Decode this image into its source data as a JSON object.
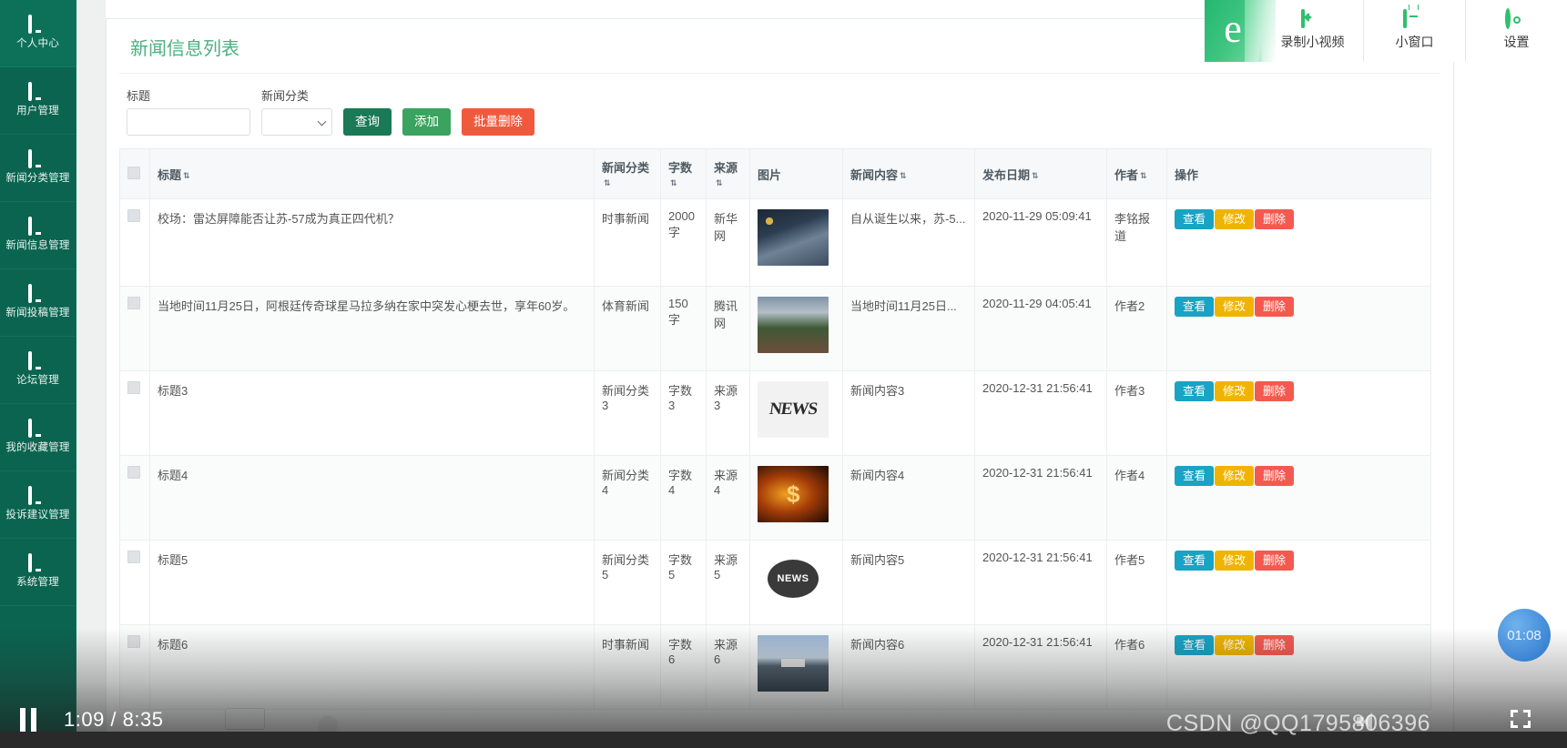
{
  "sidebar": {
    "items": [
      {
        "label": "个人中心",
        "icon": "monitor-icon"
      },
      {
        "label": "用户管理",
        "icon": "monitor-icon"
      },
      {
        "label": "新闻分类管理",
        "icon": "monitor-icon"
      },
      {
        "label": "新闻信息管理",
        "icon": "monitor-icon"
      },
      {
        "label": "新闻投稿管理",
        "icon": "monitor-icon"
      },
      {
        "label": "论坛管理",
        "icon": "monitor-icon"
      },
      {
        "label": "我的收藏管理",
        "icon": "monitor-icon"
      },
      {
        "label": "投诉建议管理",
        "icon": "monitor-icon"
      },
      {
        "label": "系统管理",
        "icon": "monitor-icon"
      }
    ]
  },
  "page": {
    "title": "新闻信息列表"
  },
  "search": {
    "title_label": "标题",
    "title_value": "",
    "title_placeholder": "",
    "category_label": "新闻分类",
    "category_value": "",
    "buttons": {
      "query": "查询",
      "add": "添加",
      "batch_delete": "批量删除"
    }
  },
  "table": {
    "columns": [
      {
        "key": "checkbox",
        "label": "",
        "sortable": false
      },
      {
        "key": "title",
        "label": "标题",
        "sortable": true
      },
      {
        "key": "category",
        "label": "新闻分类",
        "sortable": true
      },
      {
        "key": "words",
        "label": "字数",
        "sortable": true
      },
      {
        "key": "source",
        "label": "来源",
        "sortable": true
      },
      {
        "key": "image",
        "label": "图片",
        "sortable": false
      },
      {
        "key": "content",
        "label": "新闻内容",
        "sortable": true
      },
      {
        "key": "publish_date",
        "label": "发布日期",
        "sortable": true
      },
      {
        "key": "author",
        "label": "作者",
        "sortable": true
      },
      {
        "key": "actions",
        "label": "操作",
        "sortable": false
      }
    ],
    "sort_glyph": "⇅",
    "row_actions": {
      "view": "查看",
      "edit": "修改",
      "delete": "删除"
    },
    "rows": [
      {
        "title": "校场：雷达屏障能否让苏-57成为真正四代机？",
        "category": "时事新闻",
        "words": "2000字",
        "source": "新华网",
        "image": "fighter-jet-thumbnail",
        "content": "自从诞生以来，苏-5...",
        "publish_date": "2020-11-29 05:09:41",
        "author": "李铭报道"
      },
      {
        "title": "当地时间11月25日，阿根廷传奇球星马拉多纳在家中突发心梗去世，享年60岁。",
        "category": "体育新闻",
        "words": "150字",
        "source": "腾讯网",
        "image": "stadium-celebration-thumbnail",
        "content": "当地时间11月25日...",
        "publish_date": "2020-11-29 04:05:41",
        "author": "作者2"
      },
      {
        "title": "标题3",
        "category": "新闻分类3",
        "words": "字数3",
        "source": "来源3",
        "image": "news-newspaper-thumbnail",
        "content": "新闻内容3",
        "publish_date": "2020-12-31 21:56:41",
        "author": "作者3"
      },
      {
        "title": "标题4",
        "category": "新闻分类4",
        "words": "字数4",
        "source": "来源4",
        "image": "dollar-fire-thumbnail",
        "content": "新闻内容4",
        "publish_date": "2020-12-31 21:56:41",
        "author": "作者4"
      },
      {
        "title": "标题5",
        "category": "新闻分类5",
        "words": "字数5",
        "source": "来源5",
        "image": "news-globe-badge-thumbnail",
        "content": "新闻内容5",
        "publish_date": "2020-12-31 21:56:41",
        "author": "作者5"
      },
      {
        "title": "标题6",
        "category": "时事新闻",
        "words": "字数6",
        "source": "来源6",
        "image": "naval-ship-thumbnail",
        "content": "新闻内容6",
        "publish_date": "2020-12-31 21:56:41",
        "author": "作者6"
      }
    ]
  },
  "browser_toolbar": {
    "logo": "e",
    "items": [
      {
        "label": "录制小视频",
        "icon": "video-record-icon"
      },
      {
        "label": "小窗口",
        "icon": "mini-window-icon"
      },
      {
        "label": "设置",
        "icon": "gear-icon"
      }
    ]
  },
  "video_player": {
    "state_icon": "pause-icon",
    "current_time": "1:09",
    "separator": "/",
    "total_time": "8:35",
    "time_display": "1:09 / 8:35",
    "bubble_time": "01:08",
    "volume_icon": "volume-icon",
    "fullscreen_icon": "fullscreen-icon"
  },
  "watermark": "CSDN @QQ1795806396",
  "colors": {
    "sidebar_bg": "#0a6450",
    "title_green": "#4caf82",
    "btn_query": "#1a7a55",
    "btn_add": "#3aa35f",
    "btn_batch": "#f05a3c",
    "act_view": "#19a3c4",
    "act_edit": "#f0b400",
    "act_delete": "#f4594f",
    "browser_green": "#2fbf6d"
  }
}
